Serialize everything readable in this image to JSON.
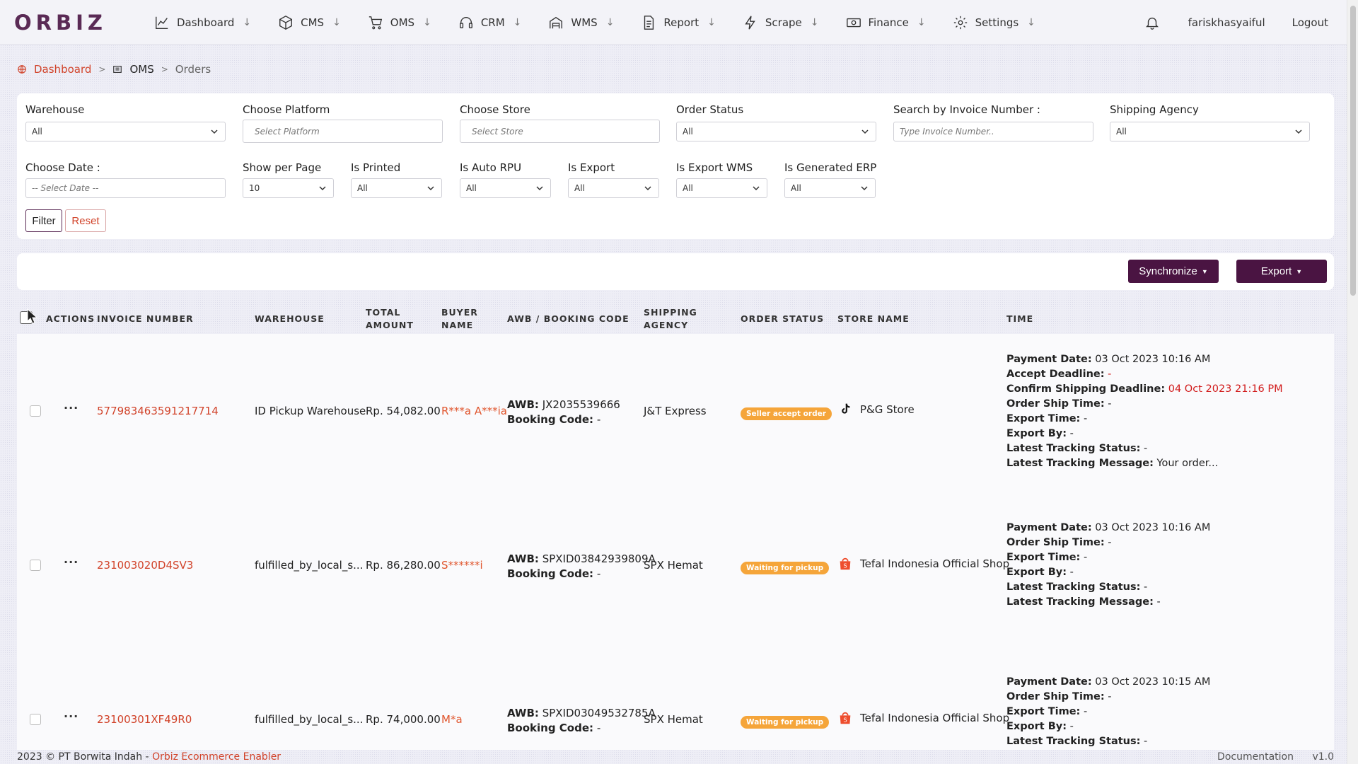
{
  "brand": {
    "logo_text": "ORBIZ"
  },
  "nav": {
    "items": [
      {
        "label": "Dashboard",
        "icon": "chart-line-icon"
      },
      {
        "label": "CMS",
        "icon": "box-icon"
      },
      {
        "label": "OMS",
        "icon": "cart-icon"
      },
      {
        "label": "CRM",
        "icon": "headset-icon"
      },
      {
        "label": "WMS",
        "icon": "warehouse-icon"
      },
      {
        "label": "Report",
        "icon": "document-icon"
      },
      {
        "label": "Scrape",
        "icon": "lightning-icon"
      },
      {
        "label": "Finance",
        "icon": "cash-icon"
      },
      {
        "label": "Settings",
        "icon": "gear-icon"
      }
    ],
    "arrow": "↓",
    "username": "fariskhasyaiful",
    "logout": "Logout"
  },
  "breadcrumb": {
    "home": "Dashboard",
    "section": "OMS",
    "current": "Orders",
    "separator": ">"
  },
  "filters": {
    "warehouse": {
      "label": "Warehouse",
      "value": "All"
    },
    "platform": {
      "label": "Choose Platform",
      "placeholder": "Select Platform"
    },
    "store": {
      "label": "Choose Store",
      "placeholder": "Select Store"
    },
    "order_status": {
      "label": "Order Status",
      "value": "All"
    },
    "invoice": {
      "label": "Search by Invoice Number :",
      "placeholder": "Type Invoice Number.."
    },
    "shipping_agency": {
      "label": "Shipping Agency",
      "value": "All"
    },
    "date": {
      "label": "Choose Date :",
      "placeholder": "-- Select Date --"
    },
    "per_page": {
      "label": "Show per Page",
      "value": "10"
    },
    "is_printed": {
      "label": "Is Printed",
      "value": "All"
    },
    "is_auto_rpu": {
      "label": "Is Auto RPU",
      "value": "All"
    },
    "is_export": {
      "label": "Is Export",
      "value": "All"
    },
    "is_export_wms": {
      "label": "Is Export WMS",
      "value": "All"
    },
    "is_generated_erp": {
      "label": "Is Generated ERP",
      "value": "All"
    },
    "filter_button": "Filter",
    "reset_button": "Reset"
  },
  "toolbar": {
    "synchronize": "Synchronize",
    "export": "Export"
  },
  "table": {
    "headers": {
      "actions": "ACTIONS",
      "invoice": "INVOICE NUMBER",
      "warehouse": "WAREHOUSE",
      "total_1": "TOTAL",
      "total_2": "AMOUNT",
      "buyer_1": "BUYER",
      "buyer_2": "NAME",
      "awb": "AWB / BOOKING CODE",
      "agency_1": "SHIPPING",
      "agency_2": "AGENCY",
      "status": "ORDER STATUS",
      "store": "STORE NAME",
      "time": "TIME"
    },
    "labels": {
      "awb": "AWB:",
      "booking": "Booking Code:",
      "payment_date": "Payment Date:",
      "accept_deadline": "Accept Deadline:",
      "confirm_deadline": "Confirm Shipping Deadline:",
      "order_ship_time": "Order Ship Time:",
      "export_time": "Export Time:",
      "export_by": "Export By:",
      "tracking_status": "Latest Tracking Status:",
      "tracking_message": "Latest Tracking Message:",
      "actions_dots": "···"
    },
    "rows": [
      {
        "invoice": "577983463591217714",
        "warehouse": "ID Pickup Warehouse",
        "total": "Rp. 54,082.00",
        "buyer": "R***a A***ia",
        "awb": "JX2035539666",
        "booking": "-",
        "agency": "J&T Express",
        "status": "Seller accept order",
        "store_icon": "tiktok-icon",
        "store": "P&G Store",
        "payment_date": "03 Oct 2023 10:16 AM",
        "accept_deadline": "-",
        "confirm_deadline": "04 Oct 2023 21:16 PM",
        "order_ship_time": "-",
        "export_time": "-",
        "export_by": "-",
        "tracking_status": "-",
        "tracking_message": "Your order..."
      },
      {
        "invoice": "231003020D4SV3",
        "warehouse": "fulfilled_by_local_s...",
        "total": "Rp. 86,280.00",
        "buyer": "S******i",
        "awb": "SPXID03842939809A",
        "booking": "-",
        "agency": "SPX Hemat",
        "status": "Waiting for pickup",
        "store_icon": "shopee-bag-icon",
        "store": "Tefal Indonesia Official Shop",
        "payment_date": "03 Oct 2023 10:16 AM",
        "order_ship_time": "-",
        "export_time": "-",
        "export_by": "-",
        "tracking_status": "-",
        "tracking_message": "-"
      },
      {
        "invoice": "23100301XF49R0",
        "warehouse": "fulfilled_by_local_s...",
        "total": "Rp. 74,000.00",
        "buyer": "M*a",
        "awb": "SPXID03049532785A",
        "booking": "-",
        "agency": "SPX Hemat",
        "status": "Waiting for pickup",
        "store_icon": "shopee-bag-icon",
        "store": "Tefal Indonesia Official Shop",
        "payment_date": "03 Oct 2023 10:15 AM",
        "order_ship_time": "-",
        "export_time": "-",
        "export_by": "-",
        "tracking_status": "-"
      }
    ]
  },
  "footer": {
    "copyright": "2023 © PT Borwita Indah - ",
    "link": "Orbiz Ecommerce Enabler",
    "documentation": "Documentation",
    "version": "v1.0"
  },
  "colors": {
    "brand": "#5a2a55",
    "accent_red": "#d1432a",
    "button_dark": "#4a1442",
    "status_orange": "#f5a53a"
  }
}
